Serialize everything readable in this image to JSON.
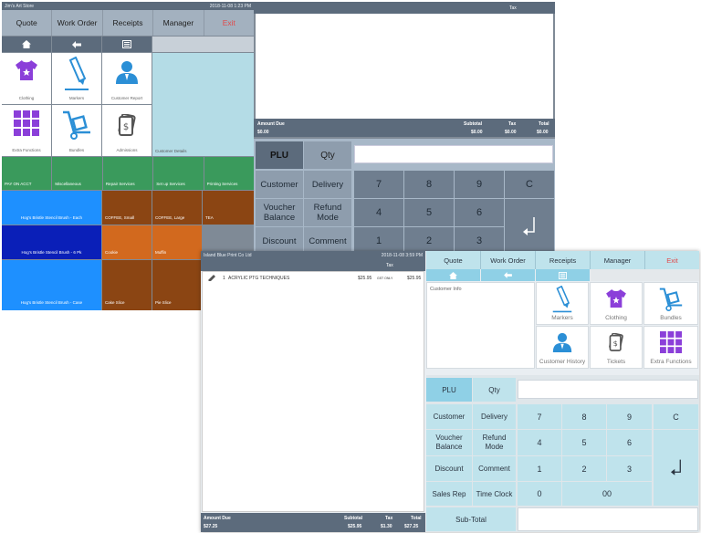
{
  "win1": {
    "title": "Jim's Art Store",
    "datetime": "2018-11-08 1:23 PM",
    "menu": [
      "Quote",
      "Work Order",
      "Receipts",
      "Manager",
      "Exit"
    ],
    "tiles": [
      "Clothing",
      "Markers",
      "Customer Report",
      "Extra Functions",
      "Bundles",
      "Admissions"
    ],
    "customer_details": "Customer Details",
    "categories": [
      "PAY ON ACCT",
      "Miscellaneous",
      "Repair Services",
      "Set up Services",
      "Printing Services"
    ],
    "products": [
      [
        "Hog's Bristle Stencil Brush - Each",
        "COFFEE, Small",
        "COFFEE, Large",
        "TEA"
      ],
      [
        "Hog's Bristle Stencil Brush - 6 Pk",
        "Cookie",
        "Muffin",
        ""
      ],
      [
        "Hog's Bristle Stencil Brush - Case",
        "Cake Slice",
        "Pie Slice",
        ""
      ]
    ],
    "receipt": {
      "tax_header": "Tax",
      "labels": [
        "Amount Due",
        "Subtotal",
        "Tax",
        "Total"
      ],
      "values": [
        "$0.00",
        "$0.00",
        "$0.00",
        "$0.00"
      ]
    },
    "keypad": {
      "plu": "PLU",
      "qty": "Qty",
      "rows": [
        [
          "Customer",
          "Delivery",
          "7",
          "8",
          "9",
          "C"
        ],
        [
          "Voucher Balance",
          "Refund Mode",
          "4",
          "5",
          "6"
        ],
        [
          "Discount",
          "Comment",
          "1",
          "2",
          "3"
        ]
      ]
    }
  },
  "win2": {
    "title": "Island Blue Print Co Ltd",
    "datetime": "2018-11-08 3:59 PM",
    "tax_header": "Tax",
    "line_item": {
      "qty": "1",
      "desc": "ACRYLIC PTG TECHNIQUES",
      "price": "$25.95",
      "tax": "GST ONLY",
      "total": "$25.95"
    },
    "totals": {
      "labels": [
        "Amount Due",
        "Subtotal",
        "Tax",
        "Total"
      ],
      "values": [
        "$27.25",
        "$25.95",
        "$1.30",
        "$27.25"
      ]
    },
    "menu": [
      "Quote",
      "Work Order",
      "Receipts",
      "Manager",
      "Exit"
    ],
    "customer_info": "Customer Info",
    "tiles": [
      "Markers",
      "Clothing",
      "Bundles",
      "Customer History",
      "Tickets",
      "Extra Functions"
    ],
    "keypad": {
      "plu": "PLU",
      "qty": "Qty",
      "rows": [
        [
          "Customer",
          "Delivery",
          "7",
          "8",
          "9",
          "C"
        ],
        [
          "Voucher Balance",
          "Refund Mode",
          "4",
          "5",
          "6"
        ],
        [
          "Discount",
          "Comment",
          "1",
          "2",
          "3"
        ],
        [
          "Sales Rep",
          "Time Clock",
          "0",
          "00"
        ]
      ],
      "subtotal": "Sub-Total"
    }
  },
  "colors": {
    "dark_panel": "#5c6b7c",
    "light_panel": "#a8b8c8",
    "sky": "#b4dce6",
    "green": "#3a9a5c",
    "blue": "#1e90ff",
    "brown": "#8b4513",
    "orange": "#d2691e",
    "purple": "#8b3fd9",
    "icon_blue": "#2b8fd6",
    "exit_red": "#e04b4b",
    "cyan_btn": "#bfe3ec"
  }
}
